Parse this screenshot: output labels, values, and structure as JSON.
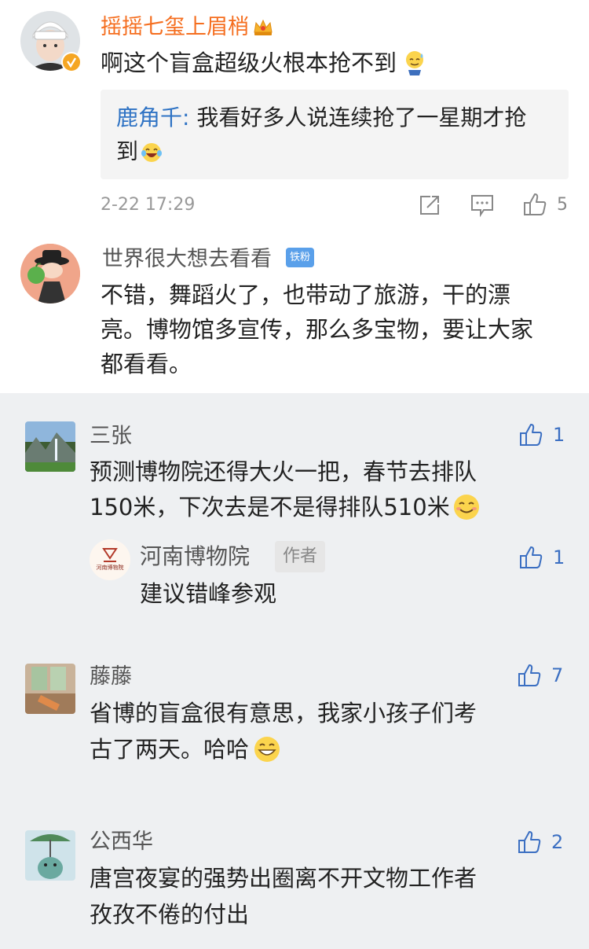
{
  "comment1": {
    "username": "摇摇七玺上眉梢",
    "text": "啊这个盲盒超级火根本抢不到",
    "reply_author": "鹿角千:",
    "reply_text_line1": " 我看好多人说连续抢了一星期才抢",
    "reply_text_line2": "到",
    "timestamp": "2-22 17:29",
    "like_count": "5"
  },
  "comment2": {
    "username": "世界很大想去看看",
    "badge": "铁粉",
    "text_line1": "不错，舞蹈火了，也带动了旅游，干的漂",
    "text_line2": "亮。博物馆多宣传，那么多宝物，要让大家",
    "text_line3": "都看看。"
  },
  "subcomments": [
    {
      "username": "三张",
      "like_count": "1",
      "text_line1": "预测博物院还得大火一把，春节去排队",
      "text_line2": "150米，下次去是不是得排队510米"
    },
    {
      "username": "河南博物院",
      "badge": "作者",
      "like_count": "1",
      "text_line1": "建议错峰参观"
    },
    {
      "username": "藤藤",
      "like_count": "7",
      "text_line1": "省博的盲盒很有意思，我家小孩子们考",
      "text_line2": "古了两天。哈哈"
    },
    {
      "username": "公西华",
      "like_count": "2",
      "text_line1": "唐宫夜宴的强势出圈离不开文物工作者",
      "text_line2": "孜孜不倦的付出"
    }
  ],
  "icons": {
    "share": "share-icon",
    "comment": "comment-icon",
    "like": "thumbs-up-icon",
    "crown": "crown-icon",
    "verified": "verified-badge-icon",
    "emoji_sweat": "emoji-sweat-icon",
    "emoji_laugh_tears": "emoji-laugh-tears-icon",
    "emoji_smile": "emoji-smile-icon",
    "emoji_grin": "emoji-grin-icon"
  },
  "colors": {
    "vip_name": "#f56e1f",
    "reply_name": "#2f73c4",
    "like_blue": "#3b6fc2",
    "grey_bg": "#eef0f2"
  }
}
